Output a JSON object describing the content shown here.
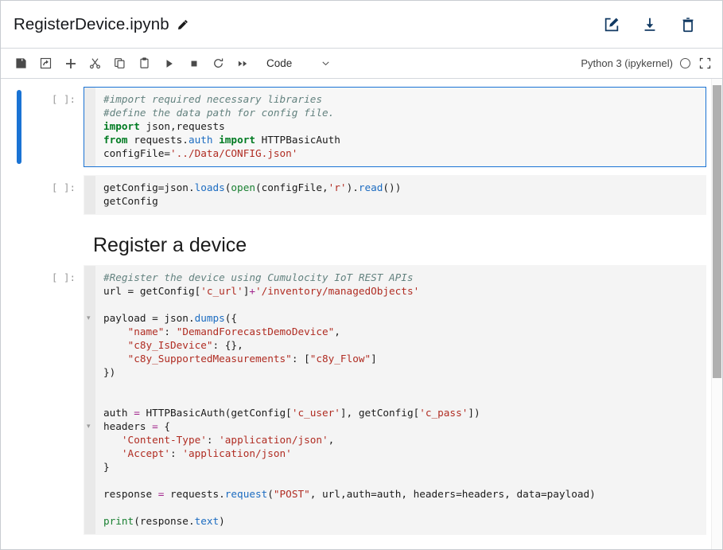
{
  "header": {
    "title": "RegisterDevice.ipynb",
    "pencil_icon": "pencil-icon",
    "actions": [
      {
        "name": "edit-icon",
        "label": "Edit"
      },
      {
        "name": "download-icon",
        "label": "Download"
      },
      {
        "name": "delete-icon",
        "label": "Delete"
      }
    ]
  },
  "toolbar": {
    "buttons": [
      {
        "name": "save-icon",
        "label": "Save"
      },
      {
        "name": "export-icon",
        "label": "Export"
      },
      {
        "name": "add-cell-icon",
        "label": "Insert cell below"
      },
      {
        "name": "cut-icon",
        "label": "Cut"
      },
      {
        "name": "copy-icon",
        "label": "Copy"
      },
      {
        "name": "paste-icon",
        "label": "Paste"
      },
      {
        "name": "run-icon",
        "label": "Run"
      },
      {
        "name": "stop-icon",
        "label": "Interrupt"
      },
      {
        "name": "restart-icon",
        "label": "Restart"
      },
      {
        "name": "restart-run-all-icon",
        "label": "Restart and run all"
      }
    ],
    "cell_type": "Code",
    "cell_type_caret": "chevron-down-icon",
    "kernel_name": "Python 3 (ipykernel)",
    "kernel_status": "idle",
    "expand_icon": "fullscreen-icon"
  },
  "notebook": {
    "cells": [
      {
        "type": "code",
        "selected": true,
        "prompt": "[ ]:",
        "lines": [
          [
            {
              "t": "#import required necessary libraries",
              "c": "c"
            }
          ],
          [
            {
              "t": "#define the data path for config file.",
              "c": "c"
            }
          ],
          [
            {
              "t": "import",
              "c": "k"
            },
            {
              "t": " json,requests",
              "c": "p"
            }
          ],
          [
            {
              "t": "from",
              "c": "k"
            },
            {
              "t": " requests.",
              "c": "p"
            },
            {
              "t": "auth",
              "c": "f"
            },
            {
              "t": " ",
              "c": "p"
            },
            {
              "t": "import",
              "c": "k"
            },
            {
              "t": " HTTPBasicAuth",
              "c": "p"
            }
          ],
          [
            {
              "t": "configFile=",
              "c": "p"
            },
            {
              "t": "'../Data/CONFIG.json'",
              "c": "s"
            }
          ]
        ],
        "folds": []
      },
      {
        "type": "code",
        "selected": false,
        "prompt": "[ ]:",
        "lines": [
          [
            {
              "t": "getConfig=json.",
              "c": "p"
            },
            {
              "t": "loads",
              "c": "f"
            },
            {
              "t": "(",
              "c": "p"
            },
            {
              "t": "open",
              "c": "kb"
            },
            {
              "t": "(configFile,",
              "c": "p"
            },
            {
              "t": "'r'",
              "c": "s"
            },
            {
              "t": ").",
              "c": "p"
            },
            {
              "t": "read",
              "c": "f"
            },
            {
              "t": "())",
              "c": "p"
            }
          ],
          [
            {
              "t": "getConfig",
              "c": "p"
            }
          ]
        ],
        "folds": []
      },
      {
        "type": "markdown",
        "selected": false,
        "prompt": "",
        "heading": "Register a device"
      },
      {
        "type": "code",
        "selected": false,
        "prompt": "[ ]:",
        "lines": [
          [
            {
              "t": "#Register the device using Cumulocity IoT REST APIs",
              "c": "c"
            }
          ],
          [
            {
              "t": "url = getConfig[",
              "c": "p"
            },
            {
              "t": "'c_url'",
              "c": "s"
            },
            {
              "t": "]",
              "c": "p"
            },
            {
              "t": "+",
              "c": "o"
            },
            {
              "t": "'/inventory/managedObjects'",
              "c": "s"
            }
          ],
          [
            {
              "t": "",
              "c": "p"
            }
          ],
          [
            {
              "t": "payload = json.",
              "c": "p"
            },
            {
              "t": "dumps",
              "c": "f"
            },
            {
              "t": "({",
              "c": "p"
            }
          ],
          [
            {
              "t": "    ",
              "c": "p"
            },
            {
              "t": "\"name\"",
              "c": "s"
            },
            {
              "t": ": ",
              "c": "p"
            },
            {
              "t": "\"DemandForecastDemoDevice\"",
              "c": "s"
            },
            {
              "t": ",",
              "c": "p"
            }
          ],
          [
            {
              "t": "    ",
              "c": "p"
            },
            {
              "t": "\"c8y_IsDevice\"",
              "c": "s"
            },
            {
              "t": ": {},",
              "c": "p"
            }
          ],
          [
            {
              "t": "    ",
              "c": "p"
            },
            {
              "t": "\"c8y_SupportedMeasurements\"",
              "c": "s"
            },
            {
              "t": ": [",
              "c": "p"
            },
            {
              "t": "\"c8y_Flow\"",
              "c": "s"
            },
            {
              "t": "]",
              "c": "p"
            }
          ],
          [
            {
              "t": "})",
              "c": "p"
            }
          ],
          [
            {
              "t": "",
              "c": "p"
            }
          ],
          [
            {
              "t": "",
              "c": "p"
            }
          ],
          [
            {
              "t": "auth ",
              "c": "p"
            },
            {
              "t": "=",
              "c": "o"
            },
            {
              "t": " HTTPBasicAuth(getConfig[",
              "c": "p"
            },
            {
              "t": "'c_user'",
              "c": "s"
            },
            {
              "t": "], getConfig[",
              "c": "p"
            },
            {
              "t": "'c_pass'",
              "c": "s"
            },
            {
              "t": "])",
              "c": "p"
            }
          ],
          [
            {
              "t": "headers ",
              "c": "p"
            },
            {
              "t": "=",
              "c": "o"
            },
            {
              "t": " {",
              "c": "p"
            }
          ],
          [
            {
              "t": "   ",
              "c": "p"
            },
            {
              "t": "'Content-Type'",
              "c": "s"
            },
            {
              "t": ": ",
              "c": "p"
            },
            {
              "t": "'application/json'",
              "c": "s"
            },
            {
              "t": ",",
              "c": "p"
            }
          ],
          [
            {
              "t": "   ",
              "c": "p"
            },
            {
              "t": "'Accept'",
              "c": "s"
            },
            {
              "t": ": ",
              "c": "p"
            },
            {
              "t": "'application/json'",
              "c": "s"
            }
          ],
          [
            {
              "t": "}",
              "c": "p"
            }
          ],
          [
            {
              "t": "",
              "c": "p"
            }
          ],
          [
            {
              "t": "response ",
              "c": "p"
            },
            {
              "t": "=",
              "c": "o"
            },
            {
              "t": " requests.",
              "c": "p"
            },
            {
              "t": "request",
              "c": "f"
            },
            {
              "t": "(",
              "c": "p"
            },
            {
              "t": "\"POST\"",
              "c": "s"
            },
            {
              "t": ", url,auth=auth, headers=headers, data=payload)",
              "c": "p"
            }
          ],
          [
            {
              "t": "",
              "c": "p"
            }
          ],
          [
            {
              "t": "print",
              "c": "kb"
            },
            {
              "t": "(response.",
              "c": "p"
            },
            {
              "t": "text",
              "c": "f"
            },
            {
              "t": ")",
              "c": "p"
            }
          ]
        ],
        "folds": [
          3,
          11
        ]
      }
    ]
  },
  "colors": {
    "accent_blue": "#1a73d4",
    "icon_dark_blue": "#123a63",
    "comment": "#63827f",
    "keyword": "#007b22",
    "string": "#b02c22",
    "function": "#1c6cc1",
    "operator": "#a2268c",
    "cell_bg": "#f4f4f4",
    "gutter": "#e9e9e9"
  }
}
